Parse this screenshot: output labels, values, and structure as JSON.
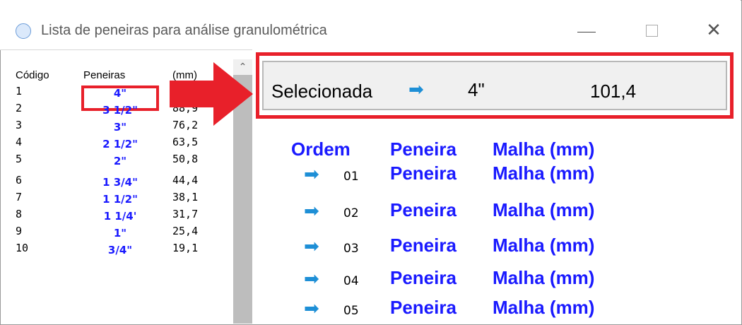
{
  "window": {
    "title": "Lista de peneiras para análise granulométrica",
    "icon": "app-circle-icon"
  },
  "left_list": {
    "headers": {
      "code": "Código",
      "sieve": "Peneiras",
      "mm": "(mm)"
    },
    "rows": [
      {
        "code": "1",
        "sieve": "4\"",
        "mm": ""
      },
      {
        "code": "2",
        "sieve": "3 1/2\"",
        "mm": "88,9"
      },
      {
        "code": "3",
        "sieve": "3\"",
        "mm": "76,2"
      },
      {
        "code": "4",
        "sieve": "2 1/2\"",
        "mm": "63,5"
      },
      {
        "code": "5",
        "sieve": "2\"",
        "mm": "50,8"
      },
      {
        "code": "6",
        "sieve": "1 3/4\"",
        "mm": "44,4"
      },
      {
        "code": "7",
        "sieve": "1 1/2\"",
        "mm": "38,1"
      },
      {
        "code": "8",
        "sieve": "1 1/4'",
        "mm": "31,7"
      },
      {
        "code": "9",
        "sieve": "1\"",
        "mm": "25,4"
      },
      {
        "code": "10",
        "sieve": "3/4\"",
        "mm": "19,1"
      }
    ]
  },
  "selection": {
    "label": "Selecionada",
    "arrow": "➡",
    "sieve": "4\"",
    "mm": "101,4"
  },
  "order_table": {
    "headers": {
      "order": "Ordem",
      "sieve": "Peneira",
      "mesh": "Malha (mm)"
    },
    "rows": [
      {
        "arrow": "➡",
        "num": "01",
        "sieve": "Peneira",
        "mesh": "Malha (mm)"
      },
      {
        "arrow": "➡",
        "num": "02",
        "sieve": "Peneira",
        "mesh": "Malha (mm)"
      },
      {
        "arrow": "➡",
        "num": "03",
        "sieve": "Peneira",
        "mesh": "Malha (mm)"
      },
      {
        "arrow": "➡",
        "num": "04",
        "sieve": "Peneira",
        "mesh": "Malha (mm)"
      },
      {
        "arrow": "➡",
        "num": "05",
        "sieve": "Peneira",
        "mesh": "Malha (mm)"
      }
    ]
  },
  "colors": {
    "highlight_red": "#e8202a",
    "text_blue": "#1a1aff",
    "arrow_blue": "#1e8fd6"
  }
}
